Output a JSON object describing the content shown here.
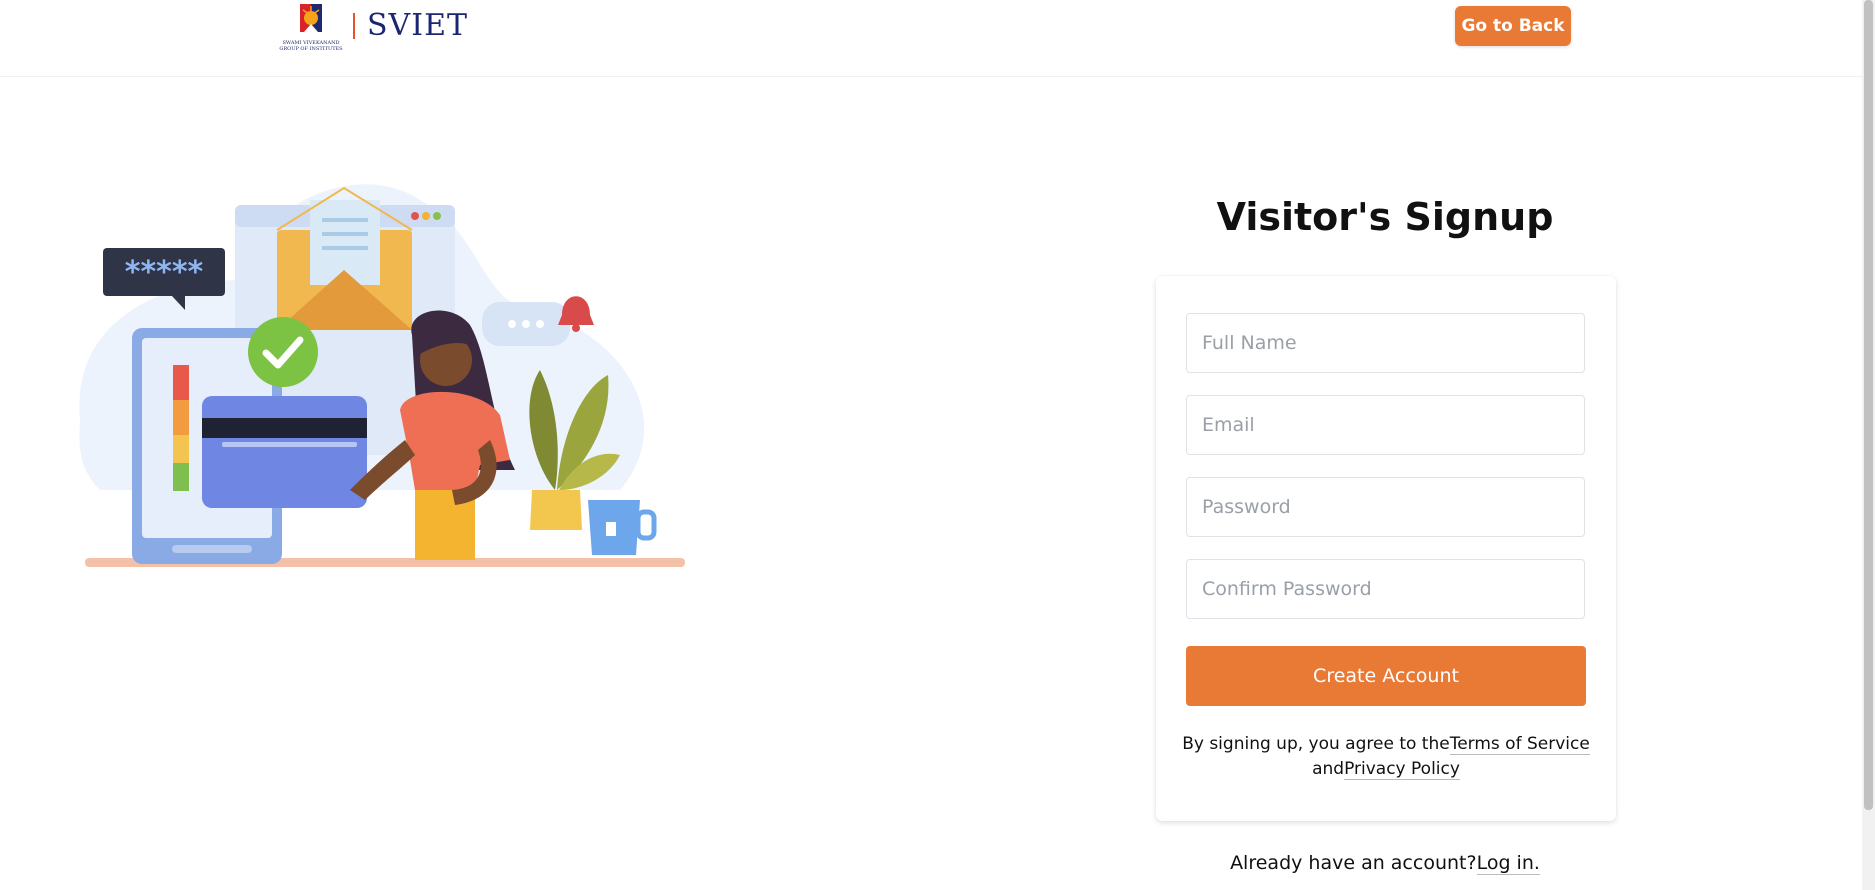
{
  "header": {
    "logo_text": "SVIET",
    "logo_subtext": "SWAMI VIVEKANAND GROUP OF INSTITUTES",
    "back_button_label": "Go to Back"
  },
  "illustration": {
    "password_bubble_text": "*****",
    "icon": "signup-illustration"
  },
  "form": {
    "title": "Visitor's Signup",
    "full_name_placeholder": "Full Name",
    "email_placeholder": "Email",
    "password_placeholder": "Password",
    "confirm_password_placeholder": "Confirm Password",
    "submit_label": "Create Account",
    "terms_prefix": "By signing up, you agree to the",
    "terms_link": "Terms of Service",
    "terms_and": "and",
    "privacy_link": "Privacy Policy"
  },
  "footer": {
    "already_text": "Already have an account?",
    "login_link": "Log in."
  },
  "colors": {
    "accent": "#e97a35",
    "brand_navy": "#1b2672"
  }
}
